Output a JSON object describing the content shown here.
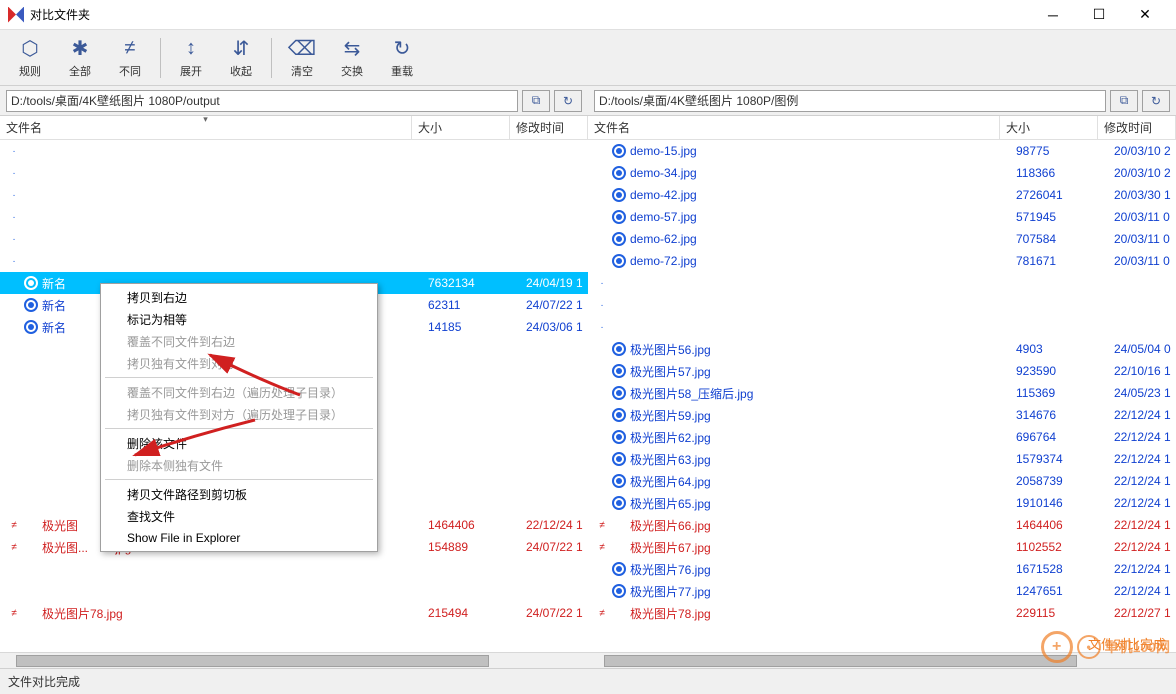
{
  "window": {
    "title": "对比文件夹"
  },
  "toolbar": [
    {
      "label": "规则",
      "icon": "⬡"
    },
    {
      "label": "全部",
      "icon": "✱"
    },
    {
      "label": "不同",
      "icon": "≠"
    },
    {
      "sep": true
    },
    {
      "label": "展开",
      "icon": "↕"
    },
    {
      "label": "收起",
      "icon": "⇵"
    },
    {
      "sep": true
    },
    {
      "label": "清空",
      "icon": "⌫"
    },
    {
      "label": "交换",
      "icon": "⇆"
    },
    {
      "label": "重载",
      "icon": "↻"
    }
  ],
  "paths": {
    "left": "D:/tools/桌面/4K壁纸图片 1080P/output",
    "right": "D:/tools/桌面/4K壁纸图片 1080P/图例"
  },
  "columns": {
    "name": "文件名",
    "size": "大小",
    "time": "修改时间"
  },
  "left_rows": [
    {
      "empty": true,
      "marker": "·"
    },
    {
      "empty": true,
      "marker": "·"
    },
    {
      "empty": true,
      "marker": "·"
    },
    {
      "empty": true,
      "marker": "·"
    },
    {
      "empty": true,
      "marker": "·"
    },
    {
      "empty": true,
      "marker": "·"
    },
    {
      "name": "新名",
      "size": "7632134",
      "time": "24/04/19 1",
      "cls": "selected",
      "icon": true
    },
    {
      "name": "新名",
      "size": "62311",
      "time": "24/07/22 1",
      "cls": "blue-text",
      "icon": true
    },
    {
      "name": "新名",
      "size": "14185",
      "time": "24/03/06 1",
      "cls": "blue-text",
      "icon": true
    },
    {
      "empty": true,
      "marker": ""
    },
    {
      "empty": true,
      "marker": ""
    },
    {
      "empty": true,
      "marker": ""
    },
    {
      "empty": true,
      "marker": ""
    },
    {
      "empty": true,
      "marker": ""
    },
    {
      "empty": true,
      "marker": ""
    },
    {
      "empty": true,
      "marker": ""
    },
    {
      "empty": true,
      "marker": ""
    },
    {
      "name": "极光图",
      "size": "1464406",
      "time": "22/12/24 1",
      "cls": "red-text",
      "marker": "≠",
      "icon": false
    },
    {
      "name": "极光图...　　.jpg",
      "size": "154889",
      "time": "24/07/22 1",
      "cls": "red-text",
      "marker": "≠",
      "icon": false
    },
    {
      "empty": true,
      "marker": ""
    },
    {
      "empty": true,
      "marker": ""
    },
    {
      "name": "极光图片78.jpg",
      "size": "215494",
      "time": "24/07/22 1",
      "cls": "red-text",
      "marker": "≠",
      "icon": false
    }
  ],
  "right_rows": [
    {
      "name": "demo-15.jpg",
      "size": "98775",
      "time": "20/03/10 2",
      "cls": "blue-text",
      "icon": true
    },
    {
      "name": "demo-34.jpg",
      "size": "118366",
      "time": "20/03/10 2",
      "cls": "blue-text",
      "icon": true
    },
    {
      "name": "demo-42.jpg",
      "size": "2726041",
      "time": "20/03/30 1",
      "cls": "blue-text",
      "icon": true
    },
    {
      "name": "demo-57.jpg",
      "size": "571945",
      "time": "20/03/11 0",
      "cls": "blue-text",
      "icon": true
    },
    {
      "name": "demo-62.jpg",
      "size": "707584",
      "time": "20/03/11 0",
      "cls": "blue-text",
      "icon": true
    },
    {
      "name": "demo-72.jpg",
      "size": "781671",
      "time": "20/03/11 0",
      "cls": "blue-text",
      "icon": true
    },
    {
      "empty": true,
      "marker": "·"
    },
    {
      "empty": true,
      "marker": "·"
    },
    {
      "empty": true,
      "marker": "·"
    },
    {
      "name": "极光图片56.jpg",
      "size": "4903",
      "time": "24/05/04 0",
      "cls": "blue-text",
      "icon": true
    },
    {
      "name": "极光图片57.jpg",
      "size": "923590",
      "time": "22/10/16 1",
      "cls": "blue-text",
      "icon": true
    },
    {
      "name": "极光图片58_压缩后.jpg",
      "size": "115369",
      "time": "24/05/23 1",
      "cls": "blue-text",
      "icon": true
    },
    {
      "name": "极光图片59.jpg",
      "size": "314676",
      "time": "22/12/24 1",
      "cls": "blue-text",
      "icon": true
    },
    {
      "name": "极光图片62.jpg",
      "size": "696764",
      "time": "22/12/24 1",
      "cls": "blue-text",
      "icon": true
    },
    {
      "name": "极光图片63.jpg",
      "size": "1579374",
      "time": "22/12/24 1",
      "cls": "blue-text",
      "icon": true
    },
    {
      "name": "极光图片64.jpg",
      "size": "2058739",
      "time": "22/12/24 1",
      "cls": "blue-text",
      "icon": true
    },
    {
      "name": "极光图片65.jpg",
      "size": "1910146",
      "time": "22/12/24 1",
      "cls": "blue-text",
      "icon": true
    },
    {
      "name": "极光图片66.jpg",
      "size": "1464406",
      "time": "22/12/24 1",
      "cls": "red-text",
      "marker": "≠",
      "icon": false
    },
    {
      "name": "极光图片67.jpg",
      "size": "1102552",
      "time": "22/12/24 1",
      "cls": "red-text",
      "marker": "≠",
      "icon": false
    },
    {
      "name": "极光图片76.jpg",
      "size": "1671528",
      "time": "22/12/24 1",
      "cls": "blue-text",
      "icon": true
    },
    {
      "name": "极光图片77.jpg",
      "size": "1247651",
      "time": "22/12/24 1",
      "cls": "blue-text",
      "icon": true
    },
    {
      "name": "极光图片78.jpg",
      "size": "229115",
      "time": "22/12/27 1",
      "cls": "red-text",
      "marker": "≠",
      "icon": false
    }
  ],
  "context_menu": [
    {
      "label": "拷贝到右边",
      "enabled": true
    },
    {
      "label": "标记为相等",
      "enabled": true
    },
    {
      "label": "覆盖不同文件到右边",
      "enabled": false
    },
    {
      "label": "拷贝独有文件到对方",
      "enabled": false
    },
    {
      "sep": true
    },
    {
      "label": "覆盖不同文件到右边（遍历处理子目录）",
      "enabled": false
    },
    {
      "label": "拷贝独有文件到对方（遍历处理子目录）",
      "enabled": false
    },
    {
      "sep": true
    },
    {
      "label": "删除该文件",
      "enabled": true
    },
    {
      "label": "删除本侧独有文件",
      "enabled": false
    },
    {
      "sep": true
    },
    {
      "label": "拷贝文件路径到剪切板",
      "enabled": true
    },
    {
      "label": "查找文件",
      "enabled": true
    },
    {
      "label": "Show File in Explorer",
      "enabled": true
    }
  ],
  "status": "文件对比完成",
  "watermark": {
    "text": "单机100网",
    "overlay": "文件对比完成"
  }
}
